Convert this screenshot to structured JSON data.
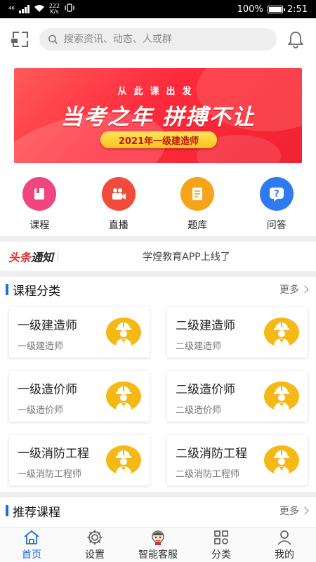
{
  "status_bar": {
    "network": "⁴⁶",
    "speed_value": "222",
    "speed_unit": "K/s",
    "battery": "100%",
    "battery_level": 1.0,
    "time": "2:51"
  },
  "search": {
    "placeholder": "搜索资讯、动态、人或群"
  },
  "banner": {
    "subtitle": "从此课出发",
    "title": "当考之年 拼搏不让",
    "pill": "2021年一级建造师"
  },
  "quick_nav": [
    {
      "label": "课程",
      "icon": "book-icon",
      "color": "#f0457f"
    },
    {
      "label": "直播",
      "icon": "video-camera-icon",
      "color": "#f24a3b"
    },
    {
      "label": "题库",
      "icon": "notebook-icon",
      "color": "#f6a41a"
    },
    {
      "label": "问答",
      "icon": "question-icon",
      "color": "#2f7af0"
    }
  ],
  "notice": {
    "badge_part1": "头条",
    "badge_part2": "通知",
    "text": "学煌教育APP上线了"
  },
  "course_section": {
    "title": "课程分类",
    "more": "更多"
  },
  "courses": [
    {
      "title": "一级建造师",
      "subtitle": "一级建造师"
    },
    {
      "title": "二级建造师",
      "subtitle": "二级建造师"
    },
    {
      "title": "一级造价师",
      "subtitle": "一级造价师"
    },
    {
      "title": "二级造价师",
      "subtitle": "二级造价师"
    },
    {
      "title": "一级消防工程",
      "subtitle": "一级消防工程师"
    },
    {
      "title": "二级消防工程",
      "subtitle": "二级消防工程师"
    }
  ],
  "recommend_section": {
    "title": "推荐课程",
    "more": "更多"
  },
  "tabbar": [
    {
      "label": "首页",
      "icon": "home-icon",
      "active": true
    },
    {
      "label": "设置",
      "icon": "gear-icon",
      "active": false
    },
    {
      "label": "智能客服",
      "icon": "assistant-avatar-icon",
      "active": false
    },
    {
      "label": "分类",
      "icon": "grid-icon",
      "active": false
    },
    {
      "label": "我的",
      "icon": "user-icon",
      "active": false
    }
  ],
  "colors": {
    "accent": "#1a6fe0",
    "banner_red": "#ff2b3c",
    "worker_yellow": "#f5b915"
  }
}
